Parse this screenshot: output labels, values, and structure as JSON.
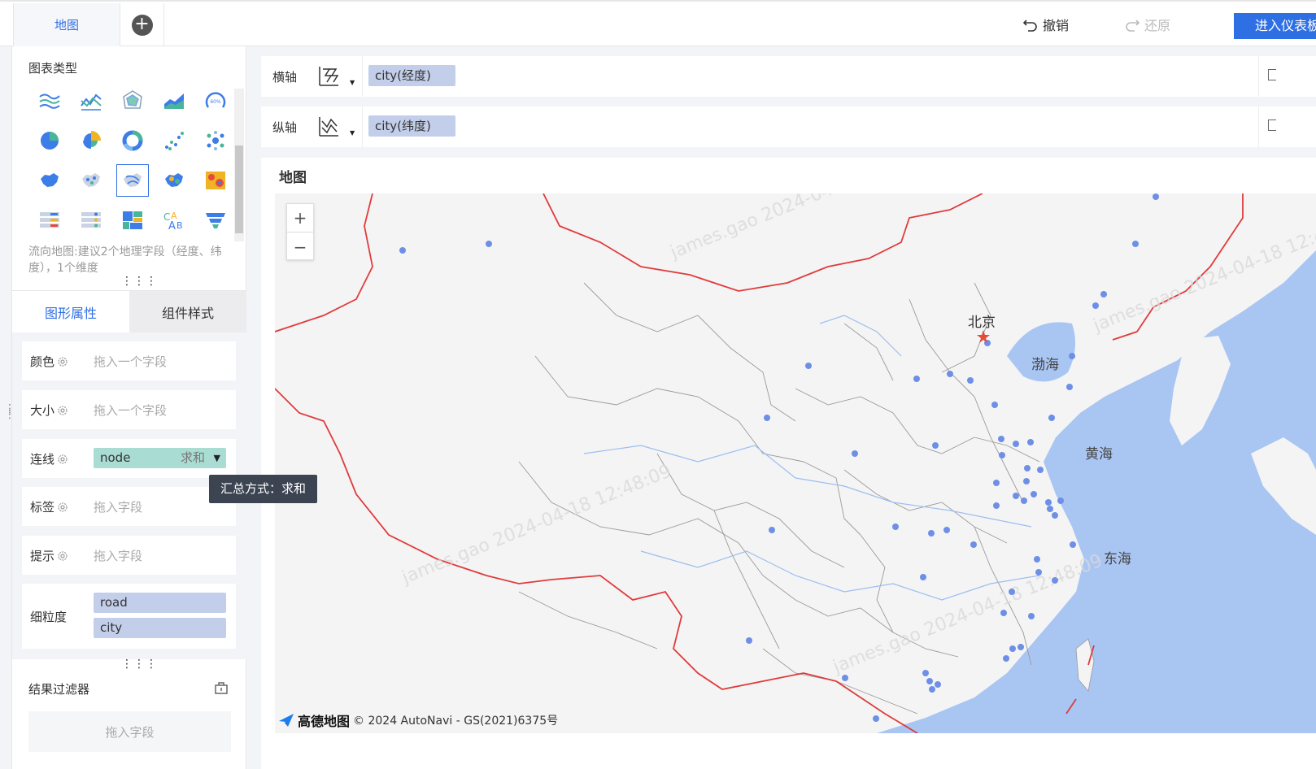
{
  "topbar": {
    "tab_label": "地图",
    "undo_label": "撤销",
    "redo_label": "还原",
    "enter_label": "进入仪表板"
  },
  "left": {
    "chart_type_title": "图表类型",
    "chart_types": [
      "multi-line-chart-icon",
      "line-chart-icon",
      "radar-chart-icon",
      "area-chart-icon",
      "gauge-chart-icon",
      "pie-chart-icon",
      "rose-chart-icon",
      "ring-chart-icon",
      "scatter-chart-icon",
      "bubble-chart-icon",
      "region-map-icon",
      "point-map-icon",
      "flow-map-icon",
      "bubble-map-icon",
      "heat-map-icon",
      "kpi-card-icon",
      "list-card-icon",
      "treemap-icon",
      "word-cloud-icon",
      "funnel-chart-icon"
    ],
    "selected_chart_index": 12,
    "hint": "流向地图:建议2个地理字段（经度、纬度），1个维度",
    "tabs": {
      "active": "图形属性",
      "inactive": "组件样式"
    },
    "props": {
      "color": {
        "label": "颜色",
        "placeholder": "拖入一个字段"
      },
      "size": {
        "label": "大小",
        "placeholder": "拖入一个字段"
      },
      "line": {
        "label": "连线",
        "field": "node",
        "aggregation": "求和"
      },
      "tag": {
        "label": "标签",
        "placeholder": "拖入字段"
      },
      "tip": {
        "label": "提示",
        "placeholder": "拖入字段"
      },
      "granularity": {
        "label": "细粒度",
        "fields": [
          "road",
          "city"
        ]
      }
    },
    "tooltip": "汇总方式：求和",
    "filter": {
      "title": "结果过滤器",
      "placeholder": "拖入字段"
    }
  },
  "axes": {
    "x": {
      "label": "横轴",
      "field": "city(经度)"
    },
    "y": {
      "label": "纵轴",
      "field": "city(纬度)"
    }
  },
  "map": {
    "title": "地图",
    "zoom_in": "+",
    "zoom_out": "−",
    "labels": {
      "beijing": "北京",
      "bohai": "渤海",
      "huanghai": "黄海",
      "donghai": "东海"
    },
    "attribution_logo": "高德地图",
    "attribution": "© 2024 AutoNavi - GS(2021)6375号",
    "watermark": "james.gao 2024-04-18 12:48:09",
    "colors": {
      "land": "#f4f4f5",
      "sea": "#a9c5f2",
      "border": "#e03b3b",
      "province": "#999999",
      "point": "#6e8fe6"
    }
  }
}
